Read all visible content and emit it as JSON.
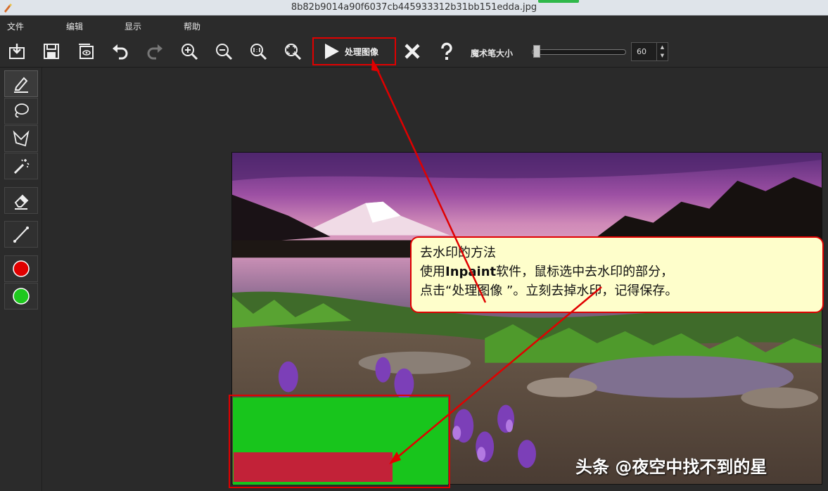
{
  "window": {
    "title": "8b82b9014a90f6037cb445933312b31bb151edda.jpg"
  },
  "menu": {
    "items": [
      "文件",
      "编辑",
      "显示",
      "帮助"
    ]
  },
  "toolbar": {
    "process_label": "处理图像",
    "brush_label": "魔术笔大小",
    "brush_size": "60",
    "buttons": [
      "open-icon",
      "save-icon",
      "save-as-icon",
      "undo-icon",
      "redo-icon",
      "zoom-in-icon",
      "zoom-out-icon",
      "zoom-1-1-icon",
      "fit-icon",
      "play-icon",
      "close-icon",
      "help-icon"
    ]
  },
  "tools": {
    "items": [
      "marker-icon",
      "lasso-icon",
      "polygon-lasso-icon",
      "magic-wand-icon",
      "eraser-icon",
      "line-icon",
      "red-color",
      "green-color"
    ],
    "colors": {
      "red": "#e00000",
      "green": "#1ec81e"
    }
  },
  "annotation": {
    "line1": "去水印的方法",
    "line2_prefix": "使用",
    "line2_bold": "Inpaint",
    "line2_suffix": "软件，鼠标选中去水印的部分，",
    "line3": "点击“处理图像 ”。立刻去掉水印，记得保存。"
  },
  "watermark": {
    "text": "头条 @夜空中找不到的星"
  },
  "colors": {
    "highlight": "#e00000",
    "callout_bg": "#fefecb",
    "selection_green": "#18c51c",
    "mask_red": "#c22238"
  }
}
